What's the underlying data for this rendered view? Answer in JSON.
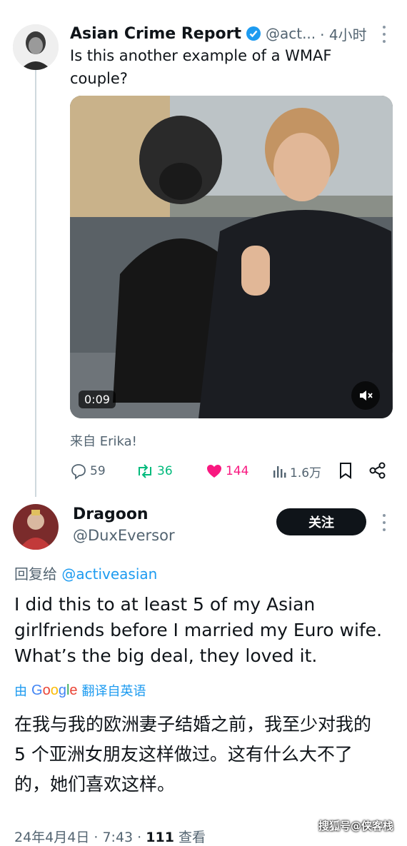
{
  "tweet": {
    "author_name": "Asian Crime Report",
    "handle": "@act...",
    "time": "· 4小时",
    "text": "Is this another example of a WMAF couple?",
    "video_duration": "0:09",
    "source": "来自 Erika!",
    "stats": {
      "replies": "59",
      "retweets": "36",
      "likes": "144",
      "views": "1.6万"
    },
    "colors": {
      "verified": "#1d9bf0",
      "retweet": "#00ba7c",
      "like": "#f91880"
    }
  },
  "reply": {
    "author_name": "Dragoon",
    "handle": "@DuxEversor",
    "follow_label": "关注",
    "replying_prefix": "回复给",
    "replying_to": "@activeasian",
    "text": "I did this to at least 5 of my Asian girlfriends before I married my Euro wife. What’s the big deal, they loved it.",
    "translate_prefix": "由",
    "translate_brand": "Google",
    "translate_suffix": "翻译自英语",
    "translation": "在我与我的欧洲妻子结婚之前，我至少对我的 5 个亚洲女朋友这样做过。这有什么大不了的，她们喜欢这样。",
    "footer_date": "24年4月4日 · 7:43 · ",
    "footer_views": "111",
    "footer_views_label": " 查看"
  },
  "watermark": "搜狐号@侠客栈"
}
